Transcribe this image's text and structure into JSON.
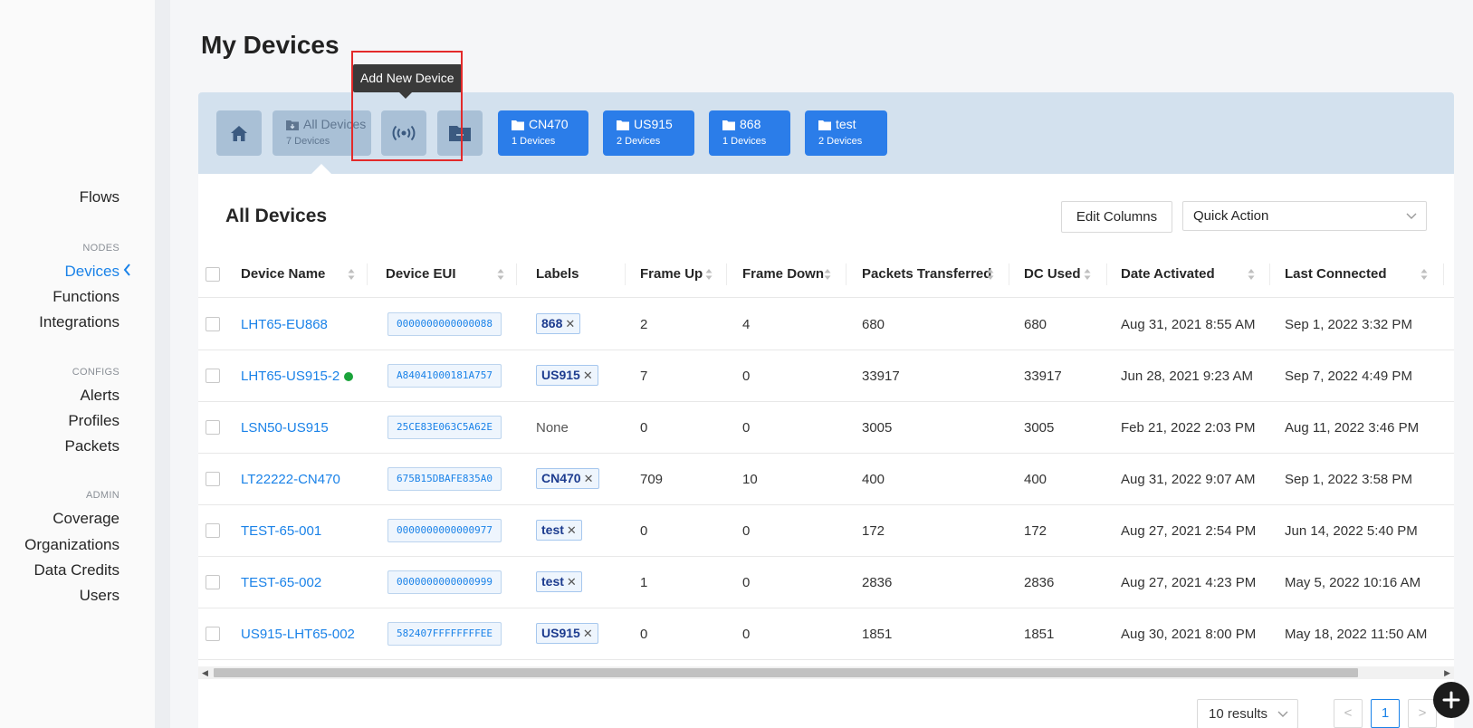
{
  "page": {
    "title": "My Devices"
  },
  "sidebar": {
    "links_top": [
      {
        "label": "Flows"
      }
    ],
    "sections": [
      {
        "title": "NODES",
        "items": [
          {
            "label": "Devices",
            "active": true
          },
          {
            "label": "Functions"
          },
          {
            "label": "Integrations"
          }
        ]
      },
      {
        "title": "CONFIGS",
        "items": [
          {
            "label": "Alerts"
          },
          {
            "label": "Profiles"
          },
          {
            "label": "Packets"
          }
        ]
      },
      {
        "title": "ADMIN",
        "items": [
          {
            "label": "Coverage"
          },
          {
            "label": "Organizations"
          },
          {
            "label": "Data Credits"
          },
          {
            "label": "Users"
          }
        ]
      }
    ]
  },
  "label_bar": {
    "all_devices": {
      "title": "All Devices",
      "count": "7 Devices"
    },
    "labels": [
      {
        "name": "CN470",
        "count": "1 Devices"
      },
      {
        "name": "US915",
        "count": "2 Devices"
      },
      {
        "name": "868",
        "count": "1 Devices"
      },
      {
        "name": "test",
        "count": "2 Devices"
      }
    ],
    "icons": {
      "home": "home-icon",
      "add_device": "broadcast-icon",
      "add_label": "folder-add-icon",
      "folder": "folder-icon"
    }
  },
  "tooltip": {
    "text": "Add New Device"
  },
  "card": {
    "title": "All Devices",
    "edit_columns_label": "Edit Columns",
    "quick_action_value": "Quick Action"
  },
  "table": {
    "columns": [
      "Device Name",
      "Device EUI",
      "Labels",
      "Frame Up",
      "Frame Down",
      "Packets Transferred",
      "DC Used",
      "Date Activated",
      "Last Connected"
    ],
    "rows": [
      {
        "name": "LHT65-EU868",
        "eui": "0000000000000088",
        "label": "868",
        "frame_up": "2",
        "frame_down": "4",
        "packets": "680",
        "dc": "680",
        "activated": "Aug 31, 2021 8:55 AM",
        "last": "Sep 1, 2022 3:32 PM",
        "online": false
      },
      {
        "name": "LHT65-US915-2",
        "eui": "A84041000181A757",
        "label": "US915",
        "frame_up": "7",
        "frame_down": "0",
        "packets": "33917",
        "dc": "33917",
        "activated": "Jun 28, 2021 9:23 AM",
        "last": "Sep 7, 2022 4:49 PM",
        "online": true
      },
      {
        "name": "LSN50-US915",
        "eui": "25CE83E063C5A62E",
        "label": "",
        "label_none": "None",
        "frame_up": "0",
        "frame_down": "0",
        "packets": "3005",
        "dc": "3005",
        "activated": "Feb 21, 2022 2:03 PM",
        "last": "Aug 11, 2022 3:46 PM",
        "online": false
      },
      {
        "name": "LT22222-CN470",
        "eui": "675B15DBAFE835A0",
        "label": "CN470",
        "frame_up": "709",
        "frame_down": "10",
        "packets": "400",
        "dc": "400",
        "activated": "Aug 31, 2022 9:07 AM",
        "last": "Sep 1, 2022 3:58 PM",
        "online": false
      },
      {
        "name": "TEST-65-001",
        "eui": "0000000000000977",
        "label": "test",
        "frame_up": "0",
        "frame_down": "0",
        "packets": "172",
        "dc": "172",
        "activated": "Aug 27, 2021 2:54 PM",
        "last": "Jun 14, 2022 5:40 PM",
        "online": false
      },
      {
        "name": "TEST-65-002",
        "eui": "0000000000000999",
        "label": "test",
        "frame_up": "1",
        "frame_down": "0",
        "packets": "2836",
        "dc": "2836",
        "activated": "Aug 27, 2021 4:23 PM",
        "last": "May 5, 2022 10:16 AM",
        "online": false
      },
      {
        "name": "US915-LHT65-002",
        "eui": "582407FFFFFFFFEE",
        "label": "US915",
        "frame_up": "0",
        "frame_down": "0",
        "packets": "1851",
        "dc": "1851",
        "activated": "Aug 30, 2021 8:00 PM",
        "last": "May 18, 2022 11:50 AM",
        "online": false
      }
    ]
  },
  "pagination": {
    "results_label": "10 results",
    "current_page": "1",
    "prev": "<",
    "next": ">"
  },
  "colors": {
    "primary": "#1a82e8",
    "label_blue": "#2b7de9",
    "online": "#1aa33a",
    "highlight": "#e32a2a"
  }
}
